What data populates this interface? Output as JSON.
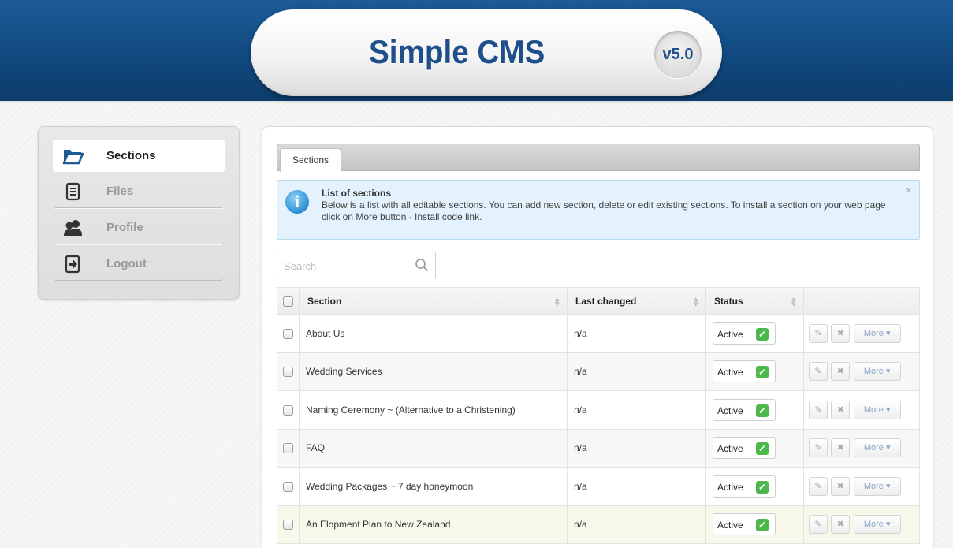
{
  "header": {
    "title": "Simple CMS",
    "version": "v5.0"
  },
  "sidebar": {
    "items": [
      {
        "label": "Sections",
        "icon": "folder-icon",
        "active": true
      },
      {
        "label": "Files",
        "icon": "document-icon",
        "active": false
      },
      {
        "label": "Profile",
        "icon": "users-icon",
        "active": false
      },
      {
        "label": "Logout",
        "icon": "logout-icon",
        "active": false
      }
    ]
  },
  "main": {
    "tab_label": "Sections",
    "info": {
      "title": "List of sections",
      "text": "Below is a list with all editable sections. You can add new section, delete or edit existing sections. To install a section on your web page click on More button - Install code link.",
      "close": "×"
    },
    "search": {
      "placeholder": "Search",
      "value": ""
    },
    "table": {
      "columns": {
        "section": "Section",
        "last_changed": "Last changed",
        "status": "Status"
      },
      "rows": [
        {
          "section": "About Us",
          "last_changed": "n/a",
          "status": "Active"
        },
        {
          "section": "Wedding Services",
          "last_changed": "n/a",
          "status": "Active"
        },
        {
          "section": "Naming Ceremony ~ (Alternative to a Christening)",
          "last_changed": "n/a",
          "status": "Active"
        },
        {
          "section": "FAQ",
          "last_changed": "n/a",
          "status": "Active"
        },
        {
          "section": "Wedding Packages ~ 7 day honeymoon",
          "last_changed": "n/a",
          "status": "Active"
        },
        {
          "section": "An Elopment Plan to New Zealand",
          "last_changed": "n/a",
          "status": "Active"
        }
      ],
      "more_label": "More"
    }
  }
}
